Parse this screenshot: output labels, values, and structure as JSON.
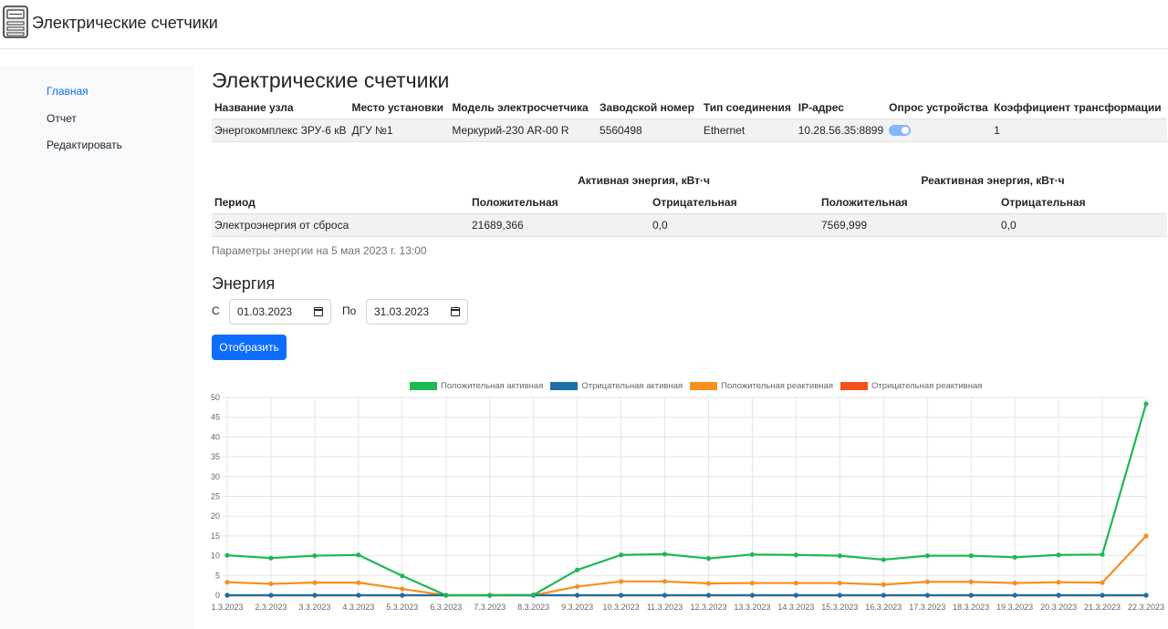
{
  "header": {
    "title": "Электрические счетчики"
  },
  "sidebar": {
    "items": [
      {
        "label": "Главная",
        "active": true
      },
      {
        "label": "Отчет",
        "active": false
      },
      {
        "label": "Редактировать",
        "active": false
      }
    ]
  },
  "page": {
    "title": "Электрические счетчики"
  },
  "device_table": {
    "headers": [
      "Название узла",
      "Место установки",
      "Модель электросчетчика",
      "Заводской номер",
      "Тип соединения",
      "IP-адрес",
      "Опрос устройства",
      "Коэффициент трансформации"
    ],
    "row": {
      "name": "Энергокомплекс ЗРУ-6 кВ",
      "location": "ДГУ №1",
      "model": "Меркурий-230 AR-00 R",
      "serial": "5560498",
      "connection": "Ethernet",
      "ip": "10.28.56.35:8899",
      "polling": true,
      "ratio": "1"
    }
  },
  "energy_table": {
    "group_active": "Активная энергия, кВт·ч",
    "group_reactive": "Реактивная энергия, кВт·ч",
    "headers": [
      "Период",
      "Положительная",
      "Отрицательная",
      "Положительная",
      "Отрицательная"
    ],
    "row": {
      "period": "Электроэнергия от сброса",
      "active_pos": "21689,366",
      "active_neg": "0,0",
      "reactive_pos": "7569,999",
      "reactive_neg": "0,0"
    }
  },
  "params_note": "Параметры энергии на 5 мая 2023 г. 13:00",
  "energy_section": {
    "title": "Энергия",
    "from_label": "С",
    "from_value": "01.03.2023",
    "to_label": "По",
    "to_value": "31.03.2023",
    "show_button": "Отобразить"
  },
  "chart_data": {
    "type": "line",
    "x": [
      "1.3.2023",
      "2.3.2023",
      "3.3.2023",
      "4.3.2023",
      "5.3.2023",
      "6.3.2023",
      "7.3.2023",
      "8.3.2023",
      "9.3.2023",
      "10.3.2023",
      "11.3.2023",
      "12.3.2023",
      "13.3.2023",
      "14.3.2023",
      "15.3.2023",
      "16.3.2023",
      "17.3.2023",
      "18.3.2023",
      "19.3.2023",
      "20.3.2023",
      "21.3.2023",
      "22.3.2023"
    ],
    "ylim": [
      0,
      50
    ],
    "yticks": [
      0,
      5,
      10,
      15,
      20,
      25,
      30,
      35,
      40,
      45,
      50
    ],
    "grid": true,
    "legend": "top",
    "series": [
      {
        "name": "Положительная активная",
        "color": "#1db954",
        "values": [
          10.1,
          9.4,
          10.0,
          10.2,
          4.9,
          0,
          0,
          0.1,
          6.4,
          10.2,
          10.4,
          9.3,
          10.3,
          10.2,
          10.0,
          9.0,
          10.0,
          10.0,
          9.6,
          10.2,
          10.3,
          48.4
        ]
      },
      {
        "name": "Отрицательная активная",
        "color": "#1b6fa8",
        "values": [
          0,
          0,
          0,
          0,
          0,
          0,
          0,
          0,
          0,
          0,
          0,
          0,
          0,
          0,
          0,
          0,
          0,
          0,
          0,
          0,
          0,
          0
        ]
      },
      {
        "name": "Положительная реактивная",
        "color": "#f78f1e",
        "values": [
          3.3,
          2.9,
          3.2,
          3.2,
          1.6,
          0,
          0,
          0,
          2.2,
          3.5,
          3.5,
          3.0,
          3.1,
          3.1,
          3.1,
          2.7,
          3.4,
          3.4,
          3.1,
          3.3,
          3.2,
          15.0
        ]
      },
      {
        "name": "Отрицательная реактивная",
        "color": "#f4511e",
        "values": [
          0,
          0,
          0,
          0,
          0,
          0,
          0,
          0,
          0,
          0,
          0,
          0,
          0,
          0,
          0,
          0,
          0,
          0,
          0,
          0,
          0,
          0
        ]
      }
    ]
  }
}
